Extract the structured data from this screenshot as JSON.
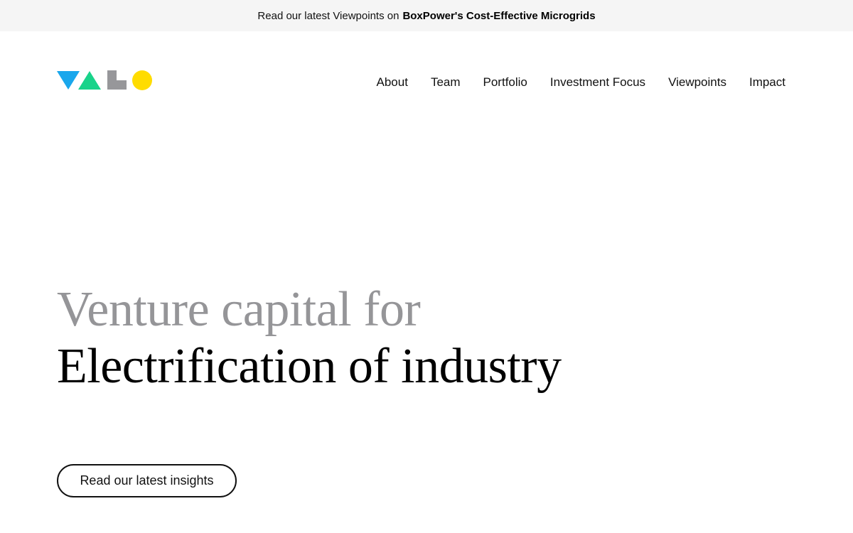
{
  "announcement": {
    "prefix": "Read our latest Viewpoints on",
    "link_text": "BoxPower's Cost-Effective Microgrids"
  },
  "logo": {
    "name": "VALO",
    "colors": {
      "v": "#1aa7ec",
      "a": "#19d38a",
      "l": "#97979a",
      "o": "#ffdc00"
    }
  },
  "nav": {
    "items": [
      {
        "label": "About"
      },
      {
        "label": "Team"
      },
      {
        "label": "Portfolio"
      },
      {
        "label": "Investment Focus"
      },
      {
        "label": "Viewpoints"
      },
      {
        "label": "Impact"
      }
    ]
  },
  "hero": {
    "line1": "Venture capital for",
    "line2": "Electrification of industry"
  },
  "cta": {
    "label": "Read our latest insights"
  }
}
